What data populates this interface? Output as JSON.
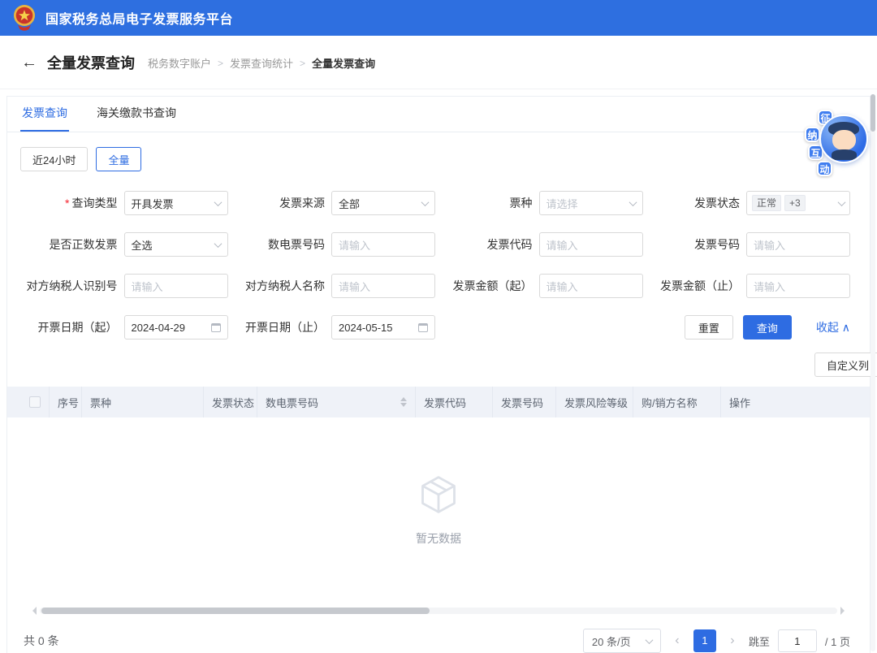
{
  "colors": {
    "primary": "#2E6CE2",
    "header": "#2E6FE0"
  },
  "app": {
    "title": "国家税务总局电子发票服务平台"
  },
  "page": {
    "back_icon": "←",
    "title": "全量发票查询",
    "breadcrumb_separator": ">",
    "breadcrumb": [
      {
        "label": "税务数字账户",
        "current": false
      },
      {
        "label": "发票查询统计",
        "current": false
      },
      {
        "label": "全量发票查询",
        "current": true
      }
    ]
  },
  "tabs": [
    {
      "key": "invoice-query",
      "label": "发票查询",
      "active": true
    },
    {
      "key": "customs-payment-query",
      "label": "海关缴款书查询",
      "active": false
    }
  ],
  "quick_range": [
    {
      "key": "last-24h",
      "label": "近24小时",
      "selected": false
    },
    {
      "key": "full",
      "label": "全量",
      "selected": true
    }
  ],
  "mascot": {
    "chars": [
      "征",
      "纳",
      "互",
      "动"
    ]
  },
  "form": {
    "fields": [
      {
        "key": "query-type",
        "label": "查询类型",
        "required": true,
        "type": "select",
        "value": "开具发票"
      },
      {
        "key": "invoice-source",
        "label": "发票来源",
        "type": "select",
        "value": "全部"
      },
      {
        "key": "ticket-type",
        "label": "票种",
        "type": "select",
        "placeholder": "请选择"
      },
      {
        "key": "invoice-status",
        "label": "发票状态",
        "type": "multiselect",
        "tags": [
          "正常",
          "+3"
        ]
      },
      {
        "key": "positive-invoice",
        "label": "是否正数发票",
        "type": "select",
        "value": "全选"
      },
      {
        "key": "digital-invoice-number",
        "label": "数电票号码",
        "type": "input",
        "placeholder": "请输入"
      },
      {
        "key": "invoice-code",
        "label": "发票代码",
        "type": "input",
        "placeholder": "请输入"
      },
      {
        "key": "invoice-number",
        "label": "发票号码",
        "type": "input",
        "placeholder": "请输入"
      },
      {
        "key": "counterparty-taxpayer-id",
        "label": "对方纳税人识别号",
        "type": "input",
        "placeholder": "请输入"
      },
      {
        "key": "counterparty-taxpayer-name",
        "label": "对方纳税人名称",
        "type": "input",
        "placeholder": "请输入"
      },
      {
        "key": "invoice-amount-from",
        "label": "发票金额（起）",
        "type": "input",
        "placeholder": "请输入"
      },
      {
        "key": "invoice-amount-to",
        "label": "发票金额（止）",
        "type": "input",
        "placeholder": "请输入"
      },
      {
        "key": "issue-date-from",
        "label": "开票日期（起）",
        "type": "date",
        "value": "2024-04-29"
      },
      {
        "key": "issue-date-to",
        "label": "开票日期（止）",
        "type": "date",
        "value": "2024-05-15"
      }
    ],
    "actions": {
      "reset": "重置",
      "query": "查询",
      "collapse": "收起",
      "collapse_icon": "∧"
    }
  },
  "toolbar": {
    "custom_columns": "自定义列"
  },
  "table": {
    "columns": [
      {
        "key": "index",
        "label": "序号"
      },
      {
        "key": "ticket-type",
        "label": "票种"
      },
      {
        "key": "invoice-status",
        "label": "发票状态"
      },
      {
        "key": "digital-number",
        "label": "数电票号码",
        "sortable": true
      },
      {
        "key": "invoice-code",
        "label": "发票代码"
      },
      {
        "key": "invoice-number",
        "label": "发票号码"
      },
      {
        "key": "risk-level",
        "label": "发票风险等级"
      },
      {
        "key": "party-name",
        "label": "购/销方名称"
      },
      {
        "key": "operation",
        "label": "操作"
      }
    ],
    "empty_text": "暂无数据"
  },
  "pagination": {
    "total": "共 0 条",
    "page_size": "20 条/页",
    "prev_icon": "‹",
    "next_icon": "›",
    "current_page": "1",
    "jump_label": "跳至",
    "jump_value": "1",
    "page_suffix": "/ 1 页"
  }
}
